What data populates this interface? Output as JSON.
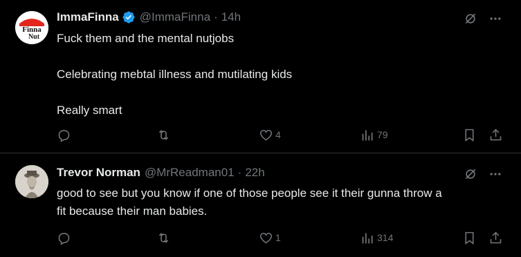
{
  "tweets": [
    {
      "name": "ImmaFinna",
      "verified": true,
      "handle": "@ImmaFinna",
      "separator": "·",
      "time": "14h",
      "avatar_text": [
        "Finna",
        "Nut"
      ],
      "lines": [
        "Fuck them and the mental nutjobs",
        "",
        "Celebrating mebtal illness and mutilating kids",
        "",
        "Really smart"
      ],
      "replies": "",
      "retweets": "",
      "likes": "4",
      "views": "79"
    },
    {
      "name": "Trevor Norman",
      "verified": false,
      "handle": "@MrReadman01",
      "separator": "·",
      "time": "22h",
      "lines": [
        "good to see but you know if one of those people see it their gunna throw a",
        "fit because their man babies."
      ],
      "replies": "",
      "retweets": "",
      "likes": "1",
      "views": "314"
    }
  ],
  "colors": {
    "background": "#000000",
    "text": "#e7e9ea",
    "muted": "#71767b",
    "verified": "#1d9bf0",
    "divider": "#2f3336",
    "avatar_red": "#e3261c"
  },
  "icons": [
    "grok-icon",
    "more-icon",
    "reply-icon",
    "retweet-icon",
    "like-icon",
    "views-icon",
    "bookmark-icon",
    "share-icon",
    "verified-icon"
  ]
}
